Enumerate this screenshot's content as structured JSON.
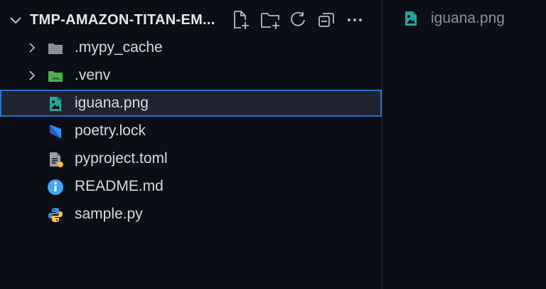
{
  "explorer": {
    "title": "TMP-AMAZON-TITAN-EM...",
    "actions": [
      {
        "name": "new-file-icon"
      },
      {
        "name": "new-folder-icon"
      },
      {
        "name": "refresh-icon"
      },
      {
        "name": "collapse-all-icon"
      },
      {
        "name": "more-actions-icon"
      }
    ],
    "items": [
      {
        "label": ".mypy_cache",
        "type": "folder",
        "icon": "folder-gray-icon",
        "expanded": false
      },
      {
        "label": ".venv",
        "type": "folder",
        "icon": "folder-green-icon",
        "expanded": false
      },
      {
        "label": "iguana.png",
        "type": "file",
        "icon": "image-file-icon",
        "selected": true
      },
      {
        "label": "poetry.lock",
        "type": "file",
        "icon": "poetry-icon"
      },
      {
        "label": "pyproject.toml",
        "type": "file",
        "icon": "toml-file-icon"
      },
      {
        "label": "README.md",
        "type": "file",
        "icon": "info-icon"
      },
      {
        "label": "sample.py",
        "type": "file",
        "icon": "python-icon"
      }
    ]
  },
  "editor": {
    "tab_label": "iguana.png",
    "tab_icon": "image-file-icon"
  },
  "colors": {
    "background": "#0b0e15",
    "selection_border": "#2c6fd1",
    "selection_bg": "#1f2330",
    "image_icon": "#26a69a",
    "folder_gray": "#8a9099",
    "folder_green": "#4caf50",
    "info_blue": "#42a5f5"
  }
}
